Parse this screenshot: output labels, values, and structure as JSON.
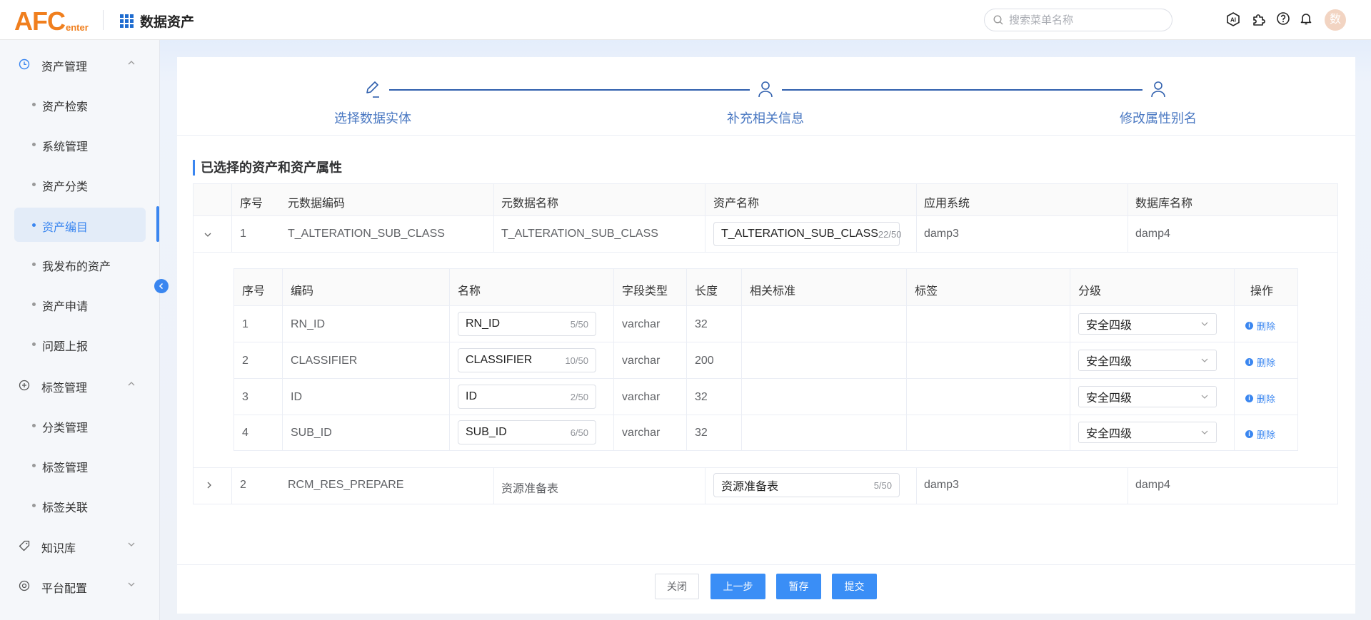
{
  "header": {
    "logo_main": "AFC",
    "logo_sub": "enter",
    "app_title": "数据资产",
    "search_placeholder": "搜索菜单名称",
    "avatar_text": "数"
  },
  "sidebar": {
    "groups": [
      {
        "label": "资产管理",
        "icon": "clock-icon",
        "expanded": true
      },
      {
        "label": "标签管理",
        "icon": "plus-circle-icon",
        "expanded": true
      },
      {
        "label": "知识库",
        "icon": "tag-icon",
        "expanded": false
      },
      {
        "label": "平台配置",
        "icon": "settings-icon",
        "expanded": false
      }
    ],
    "asset_items": [
      "资产检索",
      "系统管理",
      "资产分类",
      "资产编目",
      "我发布的资产",
      "资产申请",
      "问题上报"
    ],
    "tag_items": [
      "分类管理",
      "标签管理",
      "标签关联"
    ],
    "active_item": "资产编目"
  },
  "steps": [
    "选择数据实体",
    "补充相关信息",
    "修改属性别名"
  ],
  "section_title": "已选择的资产和资产属性",
  "outer_table": {
    "headers": [
      "序号",
      "元数据编码",
      "元数据名称",
      "资产名称",
      "应用系统",
      "数据库名称"
    ],
    "rows": [
      {
        "no": "1",
        "code": "T_ALTERATION_SUB_CLASS",
        "name": "T_ALTERATION_SUB_CLASS",
        "asset_name": "T_ALTERATION_SUB_CLASS",
        "asset_count": "22/50",
        "system": "damp3",
        "db": "damp4",
        "expanded": true
      },
      {
        "no": "2",
        "code": "RCM_RES_PREPARE",
        "name": "资源准备表",
        "asset_name": "资源准备表",
        "asset_count": "5/50",
        "system": "damp3",
        "db": "damp4",
        "expanded": false
      }
    ]
  },
  "inner_table": {
    "headers": [
      "序号",
      "编码",
      "名称",
      "字段类型",
      "长度",
      "相关标准",
      "标签",
      "分级",
      "操作"
    ],
    "rows": [
      {
        "no": "1",
        "code": "RN_ID",
        "name": "RN_ID",
        "count": "5/50",
        "type": "varchar",
        "length": "32",
        "std": "",
        "tag": "",
        "level": "安全四级",
        "action": "删除"
      },
      {
        "no": "2",
        "code": "CLASSIFIER",
        "name": "CLASSIFIER",
        "count": "10/50",
        "type": "varchar",
        "length": "200",
        "std": "",
        "tag": "",
        "level": "安全四级",
        "action": "删除"
      },
      {
        "no": "3",
        "code": "ID",
        "name": "ID",
        "count": "2/50",
        "type": "varchar",
        "length": "32",
        "std": "",
        "tag": "",
        "level": "安全四级",
        "action": "删除"
      },
      {
        "no": "4",
        "code": "SUB_ID",
        "name": "SUB_ID",
        "count": "6/50",
        "type": "varchar",
        "length": "32",
        "std": "",
        "tag": "",
        "level": "安全四级",
        "action": "删除"
      }
    ]
  },
  "footer": {
    "close": "关闭",
    "prev": "上一步",
    "save": "暂存",
    "submit": "提交"
  },
  "colors": {
    "primary": "#3a86f0",
    "logo": "#f07f1e",
    "step": "#2f5fad"
  }
}
